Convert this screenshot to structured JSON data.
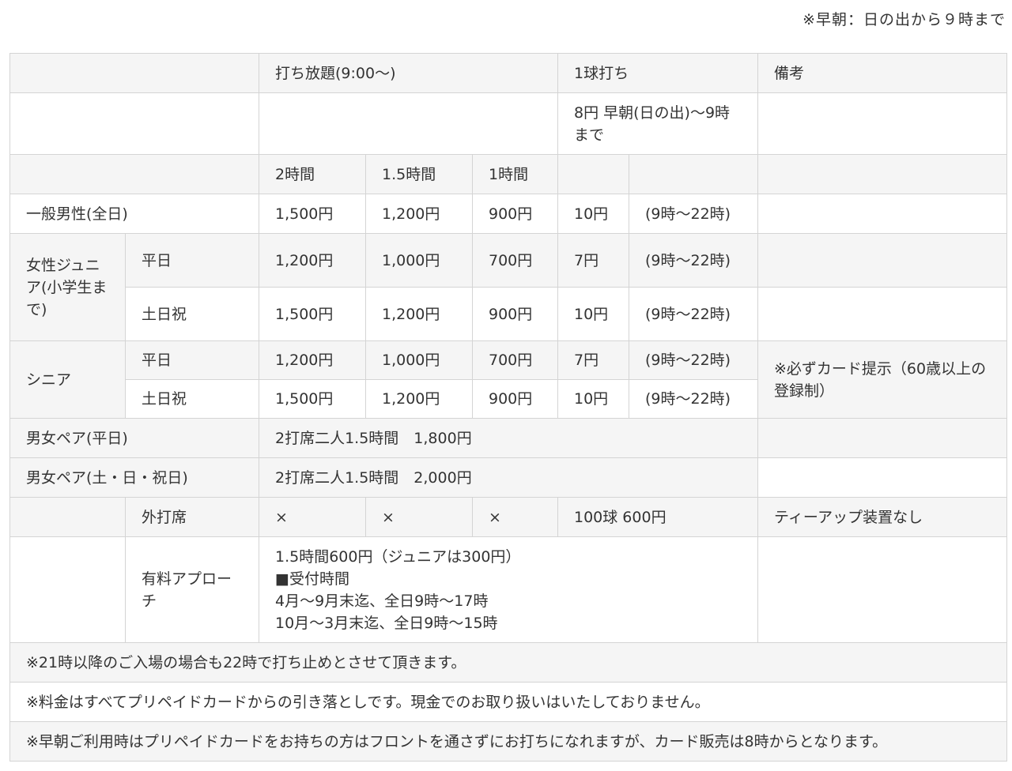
{
  "top_note": "※早朝：日の出から９時まで",
  "header": {
    "all_you_can_hit": "打ち放題(9:00～)",
    "per_ball": "1球打ち",
    "remarks": "備考"
  },
  "early_morning_price": "8円 早朝(日の出)～9時まで",
  "durations": [
    "2時間",
    "1.5時間",
    "1時間"
  ],
  "rows": {
    "men_general": {
      "label": "一般男性(全日)",
      "p2h": "1,500円",
      "p15h": "1,200円",
      "p1h": "900円",
      "ball": "10円",
      "hours": "(9時～22時)"
    },
    "women_junior": {
      "label": "女性ジュニア(小学生まで)",
      "weekday": {
        "label": "平日",
        "p2h": "1,200円",
        "p15h": "1,000円",
        "p1h": "700円",
        "ball": "7円",
        "hours": "(9時～22時)"
      },
      "weekend": {
        "label": "土日祝",
        "p2h": "1,500円",
        "p15h": "1,200円",
        "p1h": "900円",
        "ball": "10円",
        "hours": "(9時～22時)"
      }
    },
    "senior": {
      "label": "シニア",
      "remark": "※必ずカード提示（60歳以上の登録制）",
      "weekday": {
        "label": "平日",
        "p2h": "1,200円",
        "p15h": "1,000円",
        "p1h": "700円",
        "ball": "7円",
        "hours": "(9時～22時)"
      },
      "weekend": {
        "label": "土日祝",
        "p2h": "1,500円",
        "p15h": "1,200円",
        "p1h": "900円",
        "ball": "10円",
        "hours": "(9時～22時)"
      }
    },
    "pair_weekday": {
      "label": "男女ペア(平日)",
      "price": "2打席二人1.5時間　1,800円"
    },
    "pair_weekend": {
      "label": "男女ペア(土・日・祝日)",
      "price": "2打席二人1.5時間　2,000円"
    },
    "outer_seat": {
      "label": "外打席",
      "p2h": "×",
      "p15h": "×",
      "p1h": "×",
      "ball": "100球 600円",
      "remark": "ティーアップ装置なし"
    },
    "approach": {
      "label": "有料アプローチ",
      "lines": [
        "1.5時間600円（ジュニアは300円）",
        "■受付時間",
        "4月～9月末迄、全日9時～17時",
        "10月～3月末迄、全日9時～15時"
      ]
    }
  },
  "notes": [
    "※21時以降のご入場の場合も22時で打ち止めとさせて頂きます。",
    "※料金はすべてプリペイドカードからの引き落としです。現金でのお取り扱いはいたしておりません。",
    "※早朝ご利用時はプリペイドカードをお持ちの方はフロントを通さずにお打ちになれますが、カード販売は8時からとなります。"
  ]
}
